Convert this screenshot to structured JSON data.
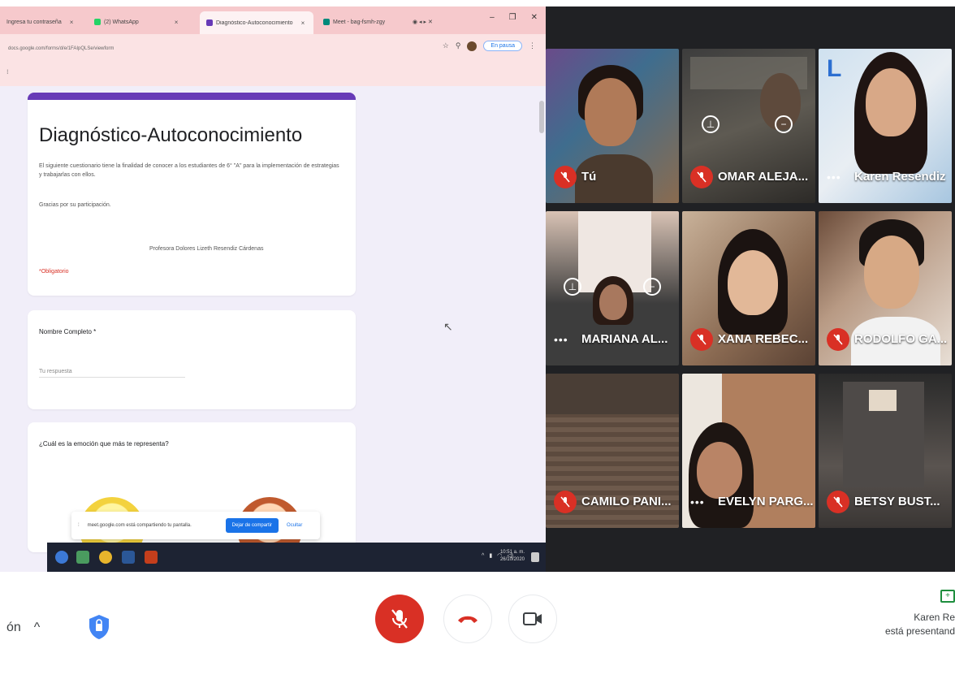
{
  "browser": {
    "tabs": [
      {
        "label": "Ingresa tu contraseña"
      },
      {
        "label": "(2) WhatsApp"
      },
      {
        "label": "Diagnóstico-Autoconocimiento"
      },
      {
        "label": "Meet - bag-fsmh-zgy"
      }
    ],
    "url": "docs.google.com/forms/d/e/1FAIpQLSe/viewform",
    "pause_label": "En pausa"
  },
  "form": {
    "title": "Diagnóstico-Autoconocimiento",
    "description": "El siguiente cuestionario tiene la finalidad de conocer a los estudiantes de 6° \"A\" para la implementación de estrategias y trabajarlas con ellos.",
    "thanks": "Gracias por su participación.",
    "signature": "Profesora Dolores Lizeth Resendiz Cárdenas",
    "required_note": "*Obligatorio",
    "q1_label": "Nombre Completo *",
    "q1_placeholder": "Tu respuesta",
    "q2_label": "¿Cuál es la emoción que más te representa?"
  },
  "toast": {
    "message": "meet.google.com está compartiendo tu pantalla.",
    "stop_label": "Dejar de compartir",
    "hide_label": "Ocultar"
  },
  "taskbar": {
    "time": "10:51 a. m.",
    "date": "26/10/2020"
  },
  "participants": [
    {
      "name": "Tú",
      "muted": true
    },
    {
      "name": "OMAR ALEJA...",
      "muted": true
    },
    {
      "name": "Karen Resendiz",
      "muted": false
    },
    {
      "name": "MARIANA AL...",
      "muted": false
    },
    {
      "name": "XANA REBEC...",
      "muted": true
    },
    {
      "name": "RODOLFO GA...",
      "muted": true
    },
    {
      "name": "CAMILO PANI...",
      "muted": true
    },
    {
      "name": "EVELYN PARG...",
      "muted": false
    },
    {
      "name": "BETSY BUST...",
      "muted": true
    }
  ],
  "bottom": {
    "left_label": "ón",
    "presenter_name": "Karen Re",
    "presenter_status": "está presentand"
  },
  "icons": {
    "mic": "mic-off-icon",
    "hangup": "call-end-icon",
    "camera": "videocam-icon",
    "shield": "shield-icon",
    "present": "present-to-all-icon"
  }
}
